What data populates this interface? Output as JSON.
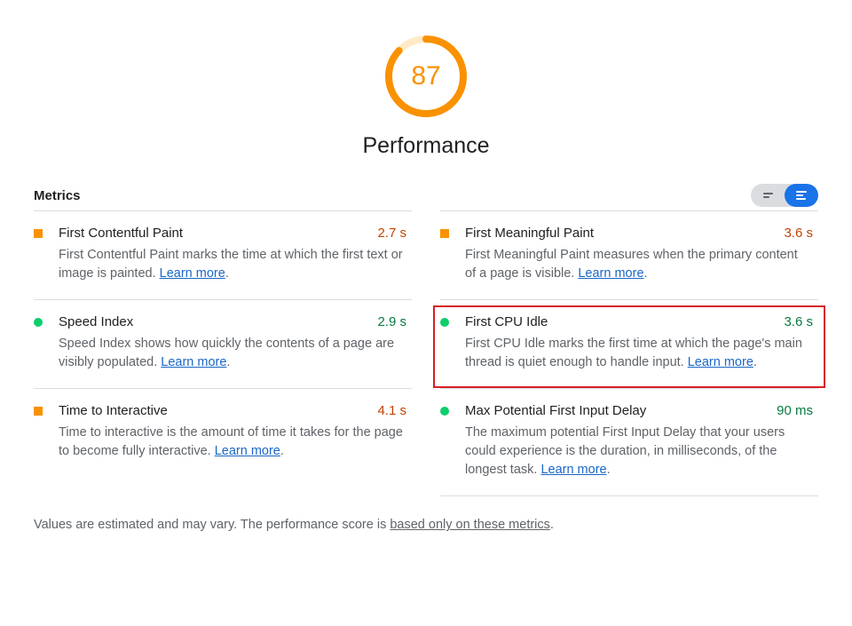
{
  "gauge": {
    "score": "87",
    "label": "Performance",
    "percent": 87,
    "ring_color": "#fa9100",
    "ring_bg": "#ffe9c6"
  },
  "metrics_heading": "Metrics",
  "learn_more_label": "Learn more",
  "metrics_left": [
    {
      "status": "square",
      "title": "First Contentful Paint",
      "desc": "First Contentful Paint marks the time at which the first text or image is painted. ",
      "value": "2.7 s",
      "value_class": "val-orange"
    },
    {
      "status": "circle",
      "title": "Speed Index",
      "desc": "Speed Index shows how quickly the contents of a page are visibly populated. ",
      "value": "2.9 s",
      "value_class": "val-green"
    },
    {
      "status": "square",
      "title": "Time to Interactive",
      "desc": "Time to interactive is the amount of time it takes for the page to become fully interactive. ",
      "value": "4.1 s",
      "value_class": "val-orange"
    }
  ],
  "metrics_right": [
    {
      "status": "square",
      "title": "First Meaningful Paint",
      "desc": "First Meaningful Paint measures when the primary content of a page is visible. ",
      "value": "3.6 s",
      "value_class": "val-orange"
    },
    {
      "status": "circle",
      "title": "First CPU Idle",
      "desc": "First CPU Idle marks the first time at which the page's main thread is quiet enough to handle input. ",
      "value": "3.6 s",
      "value_class": "val-green",
      "highlighted": true
    },
    {
      "status": "circle",
      "title": "Max Potential First Input Delay",
      "desc": "The maximum potential First Input Delay that your users could experience is the duration, in milliseconds, of the longest task. ",
      "value": "90 ms",
      "value_class": "val-green"
    }
  ],
  "footnote": {
    "pre": "Values are estimated and may vary. The performance score is ",
    "link": "based only on these metrics",
    "post": "."
  }
}
